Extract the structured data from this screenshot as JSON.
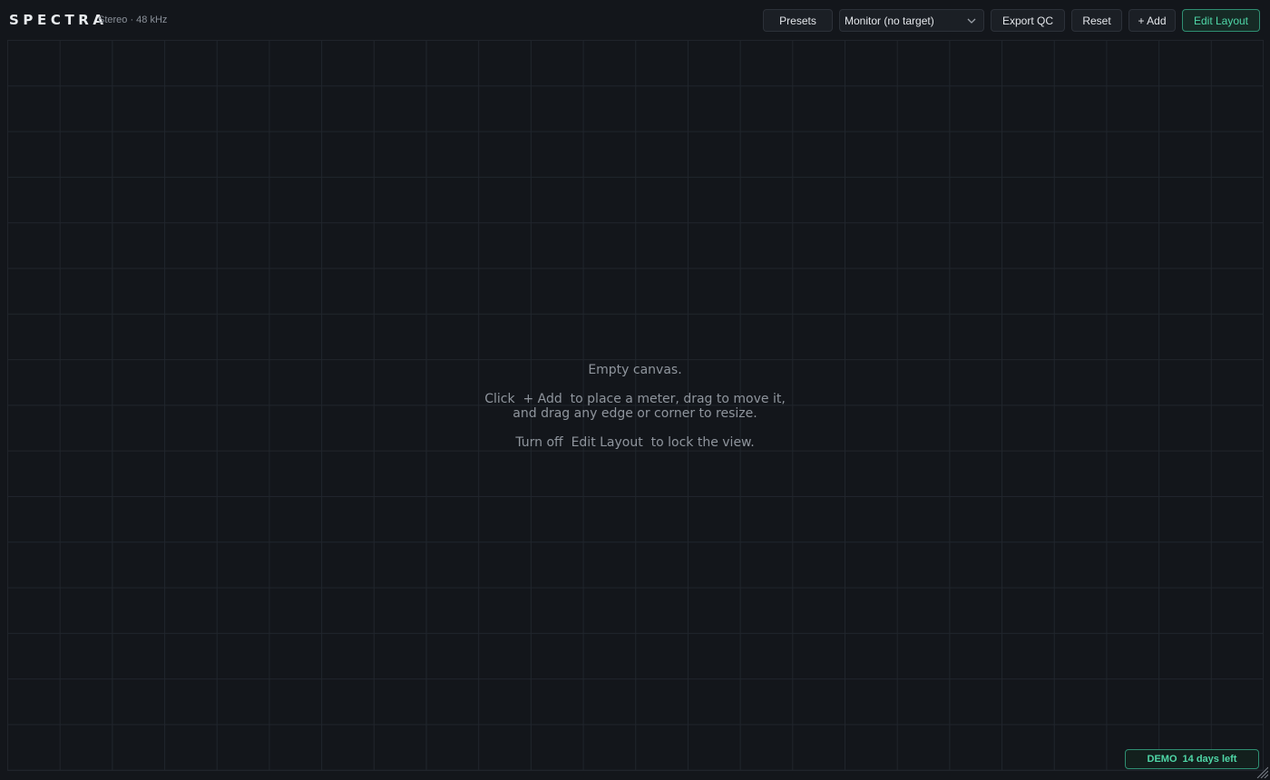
{
  "header": {
    "brand": "SPECTRA",
    "subtitle": "Stereo · 48 kHz",
    "presets_label": "Presets",
    "monitor_value": "Monitor (no target)",
    "export_label": "Export QC",
    "reset_label": "Reset",
    "add_label": "+ Add",
    "edit_layout_label": "Edit Layout"
  },
  "canvas": {
    "empty_title": "Empty canvas.",
    "line1": "Click  + Add  to place a meter, drag to move it,",
    "line2": "and drag any edge or corner to resize.",
    "line3": "Turn off  Edit Layout  to lock the view."
  },
  "badge": {
    "demo": "DEMO",
    "days_left": "14 days left"
  },
  "icons": {
    "monitor_dropdown": "chevron-down-icon",
    "resize": "resize-grip-icon"
  },
  "colors": {
    "background": "#13161b",
    "accent": "#4fd6a7",
    "accent_border": "#2f8f72"
  }
}
